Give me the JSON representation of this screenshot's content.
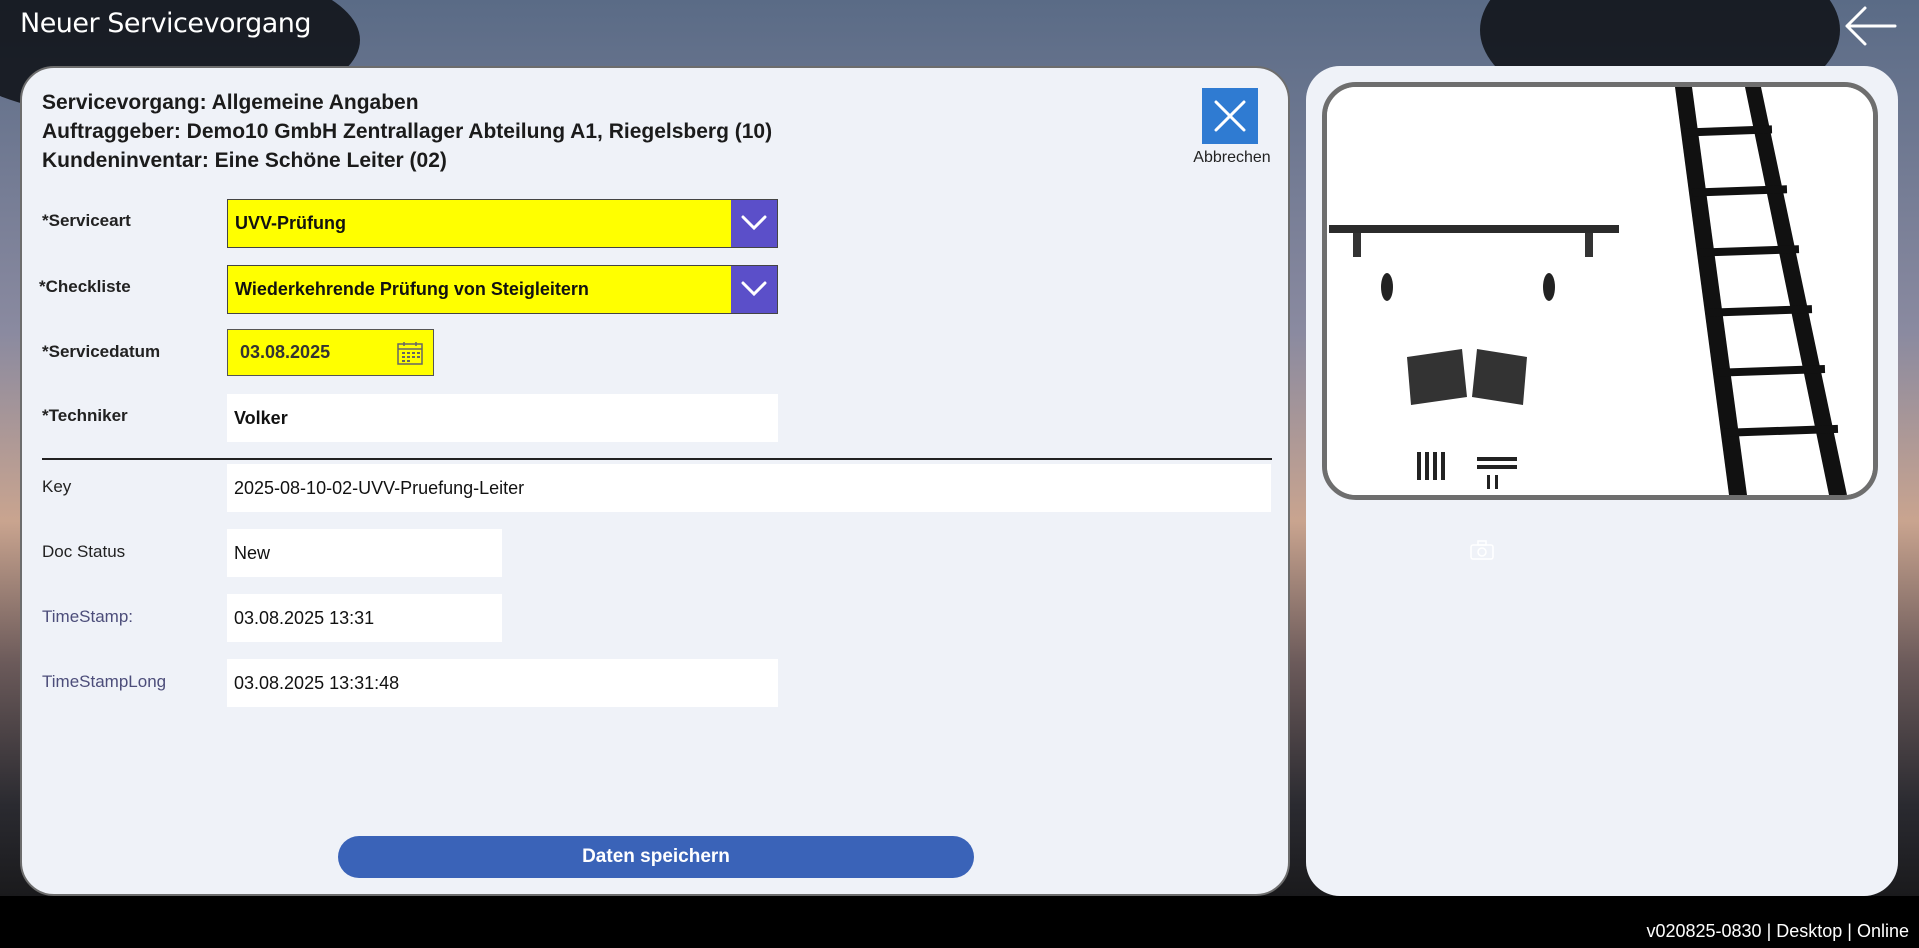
{
  "app": {
    "title": "Neuer Servicevorgang"
  },
  "header": {
    "line1": "Servicevorgang: Allgemeine Angaben",
    "line2": "Auftraggeber: Demo10 GmbH Zentrallager Abteilung A1, Riegelsberg (10)",
    "line3": "Kundeninventar: Eine Schöne Leiter (02)"
  },
  "cancel": {
    "label": "Abbrechen",
    "icon": "close-icon"
  },
  "form": {
    "serviceart": {
      "label": "*Serviceart",
      "value": "UVV-Prüfung"
    },
    "checkliste": {
      "label": "*Checkliste",
      "value": "Wiederkehrende Prüfung von Steigleitern"
    },
    "servicedatum": {
      "label": "*Servicedatum",
      "value": "03.08.2025"
    },
    "techniker": {
      "label": "*Techniker",
      "value": "Volker"
    },
    "key": {
      "label": "Key",
      "value": "2025-08-10-02-UVV-Pruefung-Leiter"
    },
    "docstatus": {
      "label": "Doc Status",
      "value": "New"
    },
    "timestamp": {
      "label": "TimeStamp:",
      "value": "03.08.2025 13:31"
    },
    "timestamplong": {
      "label": "TimeStampLong",
      "value": "03.08.2025 13:31:48"
    }
  },
  "save": {
    "label": "Daten speichern"
  },
  "status": {
    "text": "v020825-0830 | Desktop | Online"
  },
  "colors": {
    "accent": "#2f7bd2",
    "dropdown_bg": "#ffff00",
    "chevron_bg": "#5b4fc9",
    "save_bg": "#3a63b8",
    "panel_bg": "#eff2f8"
  }
}
